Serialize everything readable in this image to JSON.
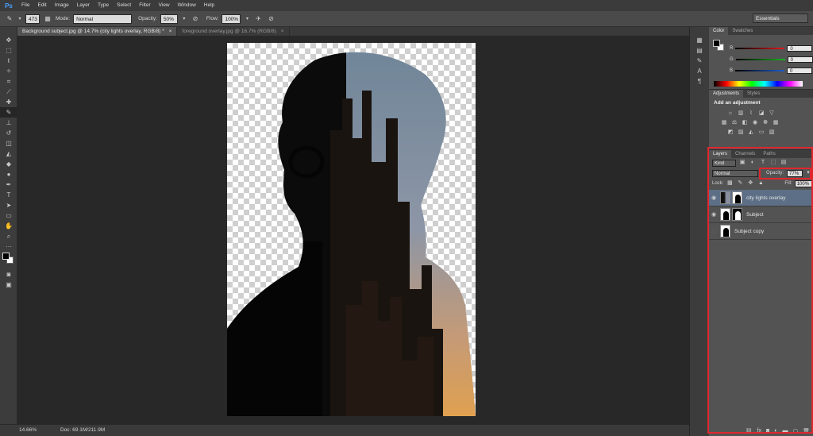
{
  "menubar": {
    "logo": "Ps",
    "items": [
      "File",
      "Edit",
      "Image",
      "Layer",
      "Type",
      "Select",
      "Filter",
      "View",
      "Window",
      "Help"
    ]
  },
  "options": {
    "brush_size": "473",
    "mode_label": "Mode:",
    "mode_value": "Normal",
    "opacity_label": "Opacity:",
    "opacity_value": "50%",
    "flow_label": "Flow:",
    "flow_value": "100%",
    "workspace": "Essentials"
  },
  "tabs": [
    {
      "label": "Background subject.jpg @ 14.7% (city lights overlay, RGB/8) *",
      "close": "×"
    },
    {
      "label": "foreground overlay.jpg @ 16.7% (RGB/8)",
      "close": "×"
    }
  ],
  "status": {
    "zoom": "14.66%",
    "doc": "Doc: 69.1M/211.9M"
  },
  "color_panel": {
    "tabs": [
      "Color",
      "Swatches"
    ],
    "r_label": "R",
    "g_label": "G",
    "b_label": "B",
    "r": "0",
    "g": "0",
    "b": "0",
    "r_color": "#e01a1a",
    "g_color": "#19b41e",
    "b_color": "#1d5ccf"
  },
  "adjust_panel": {
    "tabs": [
      "Adjustments",
      "Styles"
    ],
    "title": "Add an adjustment"
  },
  "layers_panel": {
    "tabs": [
      "Layers",
      "Channels",
      "Paths"
    ],
    "kind": "Kind",
    "blend": "Normal",
    "opacity_label": "Opacity:",
    "opacity_value": "77%",
    "lock_label": "Lock:",
    "fill_label": "Fill:",
    "fill_value": "100%",
    "layers": [
      {
        "name": "city lights overlay",
        "visible": true,
        "selected": true
      },
      {
        "name": "Subject",
        "visible": true,
        "selected": false
      },
      {
        "name": "Subject copy",
        "visible": false,
        "selected": false
      }
    ]
  },
  "icons": {
    "brush": "brush-icon",
    "eye": "eye-icon"
  }
}
